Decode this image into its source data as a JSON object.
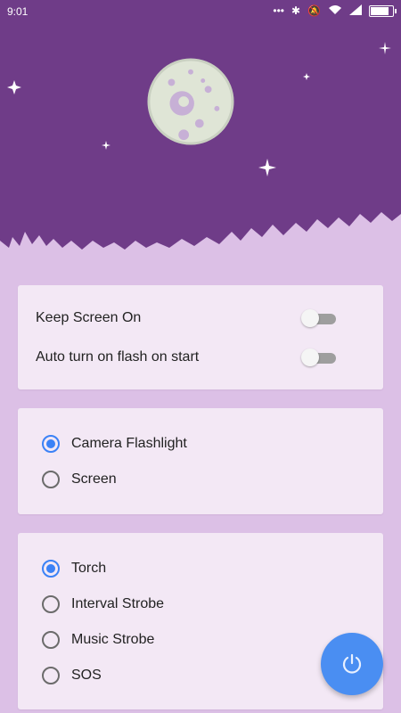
{
  "status_bar": {
    "time": "9:01",
    "icons": [
      "dots-icon",
      "bluetooth-icon",
      "mute-icon",
      "wifi-icon",
      "signal-icon",
      "battery-icon"
    ]
  },
  "settings": {
    "keep_screen_on": {
      "label": "Keep Screen On",
      "enabled": false
    },
    "auto_flash_on_start": {
      "label": "Auto turn on flash on start",
      "enabled": false
    }
  },
  "source": {
    "options": [
      {
        "label": "Camera Flashlight",
        "selected": true
      },
      {
        "label": "Screen",
        "selected": false
      }
    ]
  },
  "mode": {
    "options": [
      {
        "label": "Torch",
        "selected": true
      },
      {
        "label": "Interval Strobe",
        "selected": false
      },
      {
        "label": "Music Strobe",
        "selected": false
      },
      {
        "label": "SOS",
        "selected": false
      }
    ]
  },
  "fab": {
    "icon": "power-icon"
  },
  "colors": {
    "header": "#6f3c88",
    "background": "#dcc0e6",
    "card": "#f3e8f5",
    "accent": "#3b82f6",
    "fab": "#4a8ef2"
  }
}
